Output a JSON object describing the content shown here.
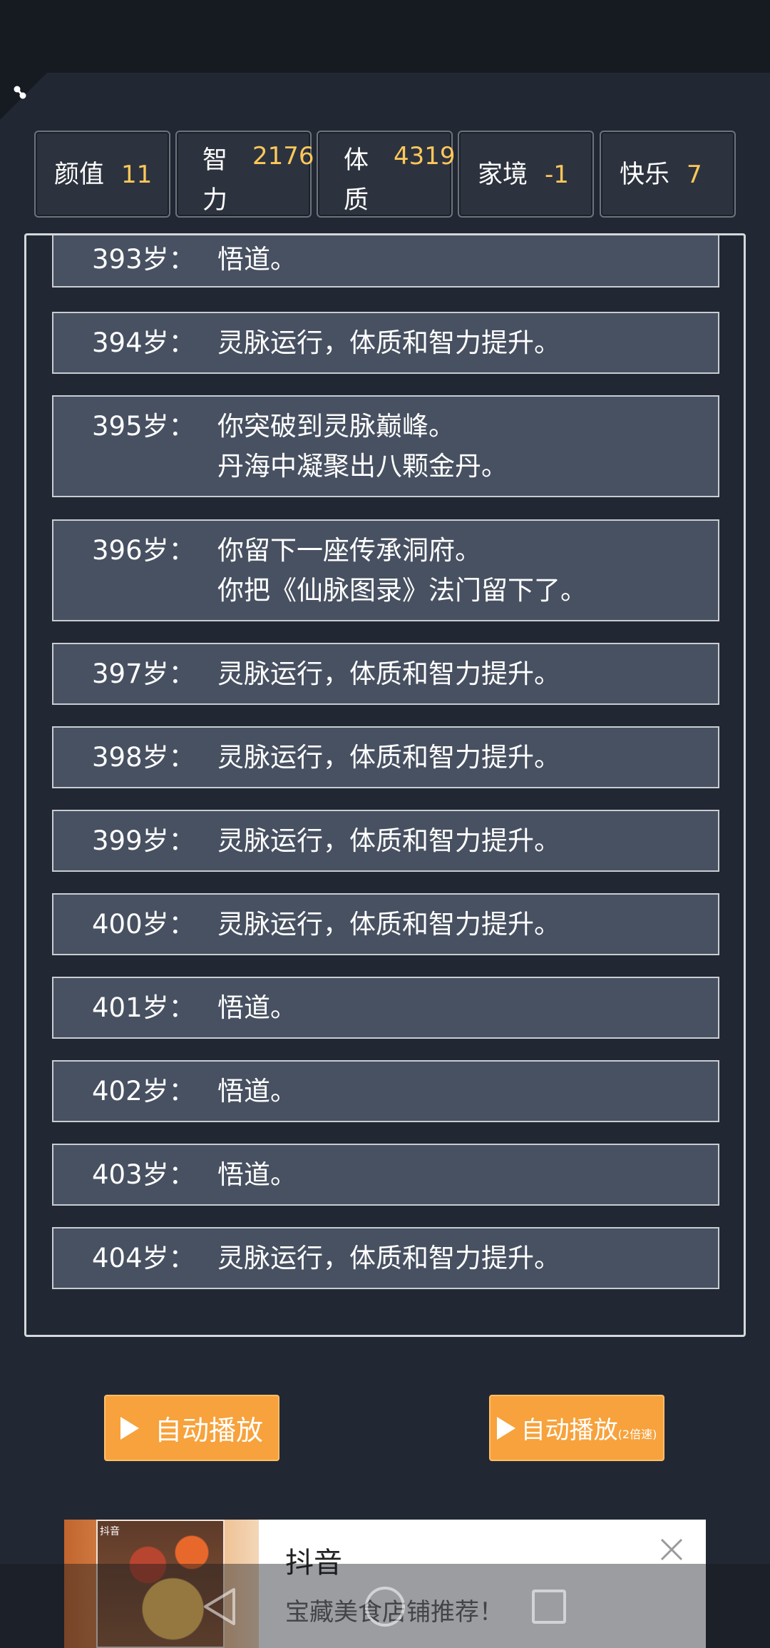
{
  "stats": [
    {
      "label": "颜值",
      "value": "11"
    },
    {
      "label": "智力",
      "value": "2176"
    },
    {
      "label": "体质",
      "value": "4319"
    },
    {
      "label": "家境",
      "value": "-1"
    },
    {
      "label": "快乐",
      "value": "7"
    }
  ],
  "log": [
    {
      "age": "393岁：",
      "line1": "悟道。",
      "line2": ""
    },
    {
      "age": "394岁：",
      "line1": "灵脉运行，体质和智力提升。",
      "line2": ""
    },
    {
      "age": "395岁：",
      "line1": "你突破到灵脉巅峰。",
      "line2": "丹海中凝聚出八颗金丹。"
    },
    {
      "age": "396岁：",
      "line1": "你留下一座传承洞府。",
      "line2": "你把《仙脉图录》法门留下了。"
    },
    {
      "age": "397岁：",
      "line1": "灵脉运行，体质和智力提升。",
      "line2": ""
    },
    {
      "age": "398岁：",
      "line1": "灵脉运行，体质和智力提升。",
      "line2": ""
    },
    {
      "age": "399岁：",
      "line1": "灵脉运行，体质和智力提升。",
      "line2": ""
    },
    {
      "age": "400岁：",
      "line1": "灵脉运行，体质和智力提升。",
      "line2": ""
    },
    {
      "age": "401岁：",
      "line1": "悟道。",
      "line2": ""
    },
    {
      "age": "402岁：",
      "line1": "悟道。",
      "line2": ""
    },
    {
      "age": "403岁：",
      "line1": "悟道。",
      "line2": ""
    },
    {
      "age": "404岁：",
      "line1": "灵脉运行，体质和智力提升。",
      "line2": ""
    }
  ],
  "buttons": {
    "auto_play": "自动播放",
    "auto_play_fast": "自动播放",
    "auto_play_fast_note": "(2倍速)"
  },
  "ad": {
    "title": "抖音",
    "desc": "宝藏美食店铺推荐！",
    "app_badge": "抖音"
  },
  "colors": {
    "background": "#222833",
    "entry_bg": "#485161",
    "value_accent": "#ffc85a",
    "button": "#f7a23c"
  }
}
